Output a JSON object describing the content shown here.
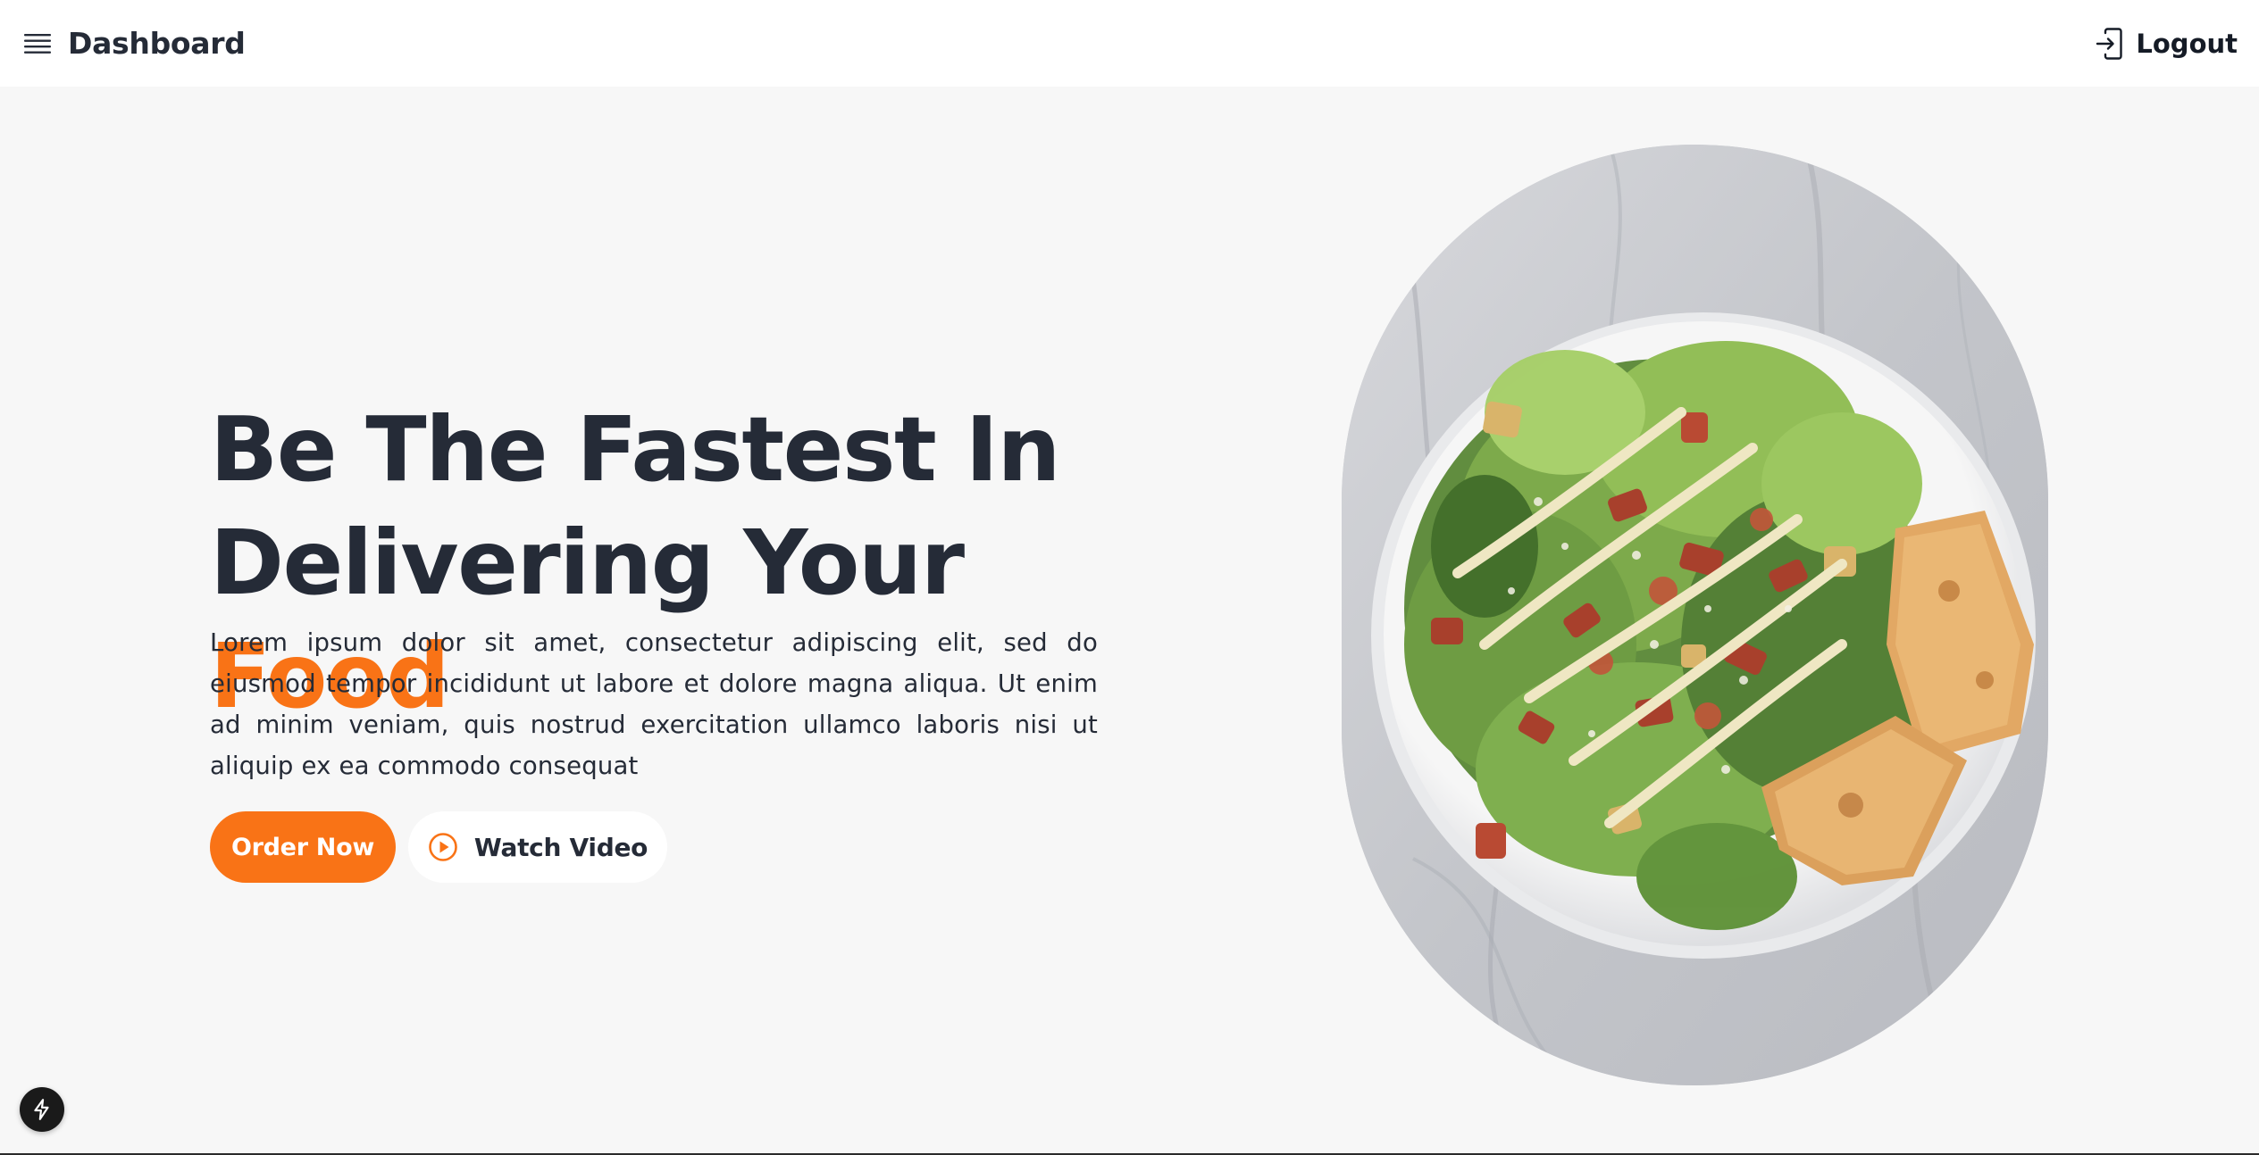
{
  "header": {
    "title": "Dashboard",
    "logout_label": "Logout",
    "menu_icon": "hamburger-icon",
    "logout_icon": "logout-icon"
  },
  "hero": {
    "headline_line1": "Be The Fastest In",
    "headline_line2_prefix": "Delivering Your ",
    "headline_line2_accent": "Food",
    "description": "Lorem ipsum dolor sit amet, consectetur adipiscing elit, sed do eiusmod tempor incididunt ut labore et dolore magna aliqua. Ut enim ad minim veniam, quis nostrud exercitation ullamco laboris nisi ut aliquip ex ea commodo consequat",
    "primary_button": "Order Now",
    "secondary_button": "Watch Video",
    "secondary_icon": "play-circle-icon",
    "image_subject": "salad-plate-image"
  },
  "colors": {
    "accent": "#f97316",
    "text_dark": "#252b37",
    "background": "#f7f7f7",
    "header_bg": "#ffffff"
  },
  "badge_icon": "bolt-icon"
}
